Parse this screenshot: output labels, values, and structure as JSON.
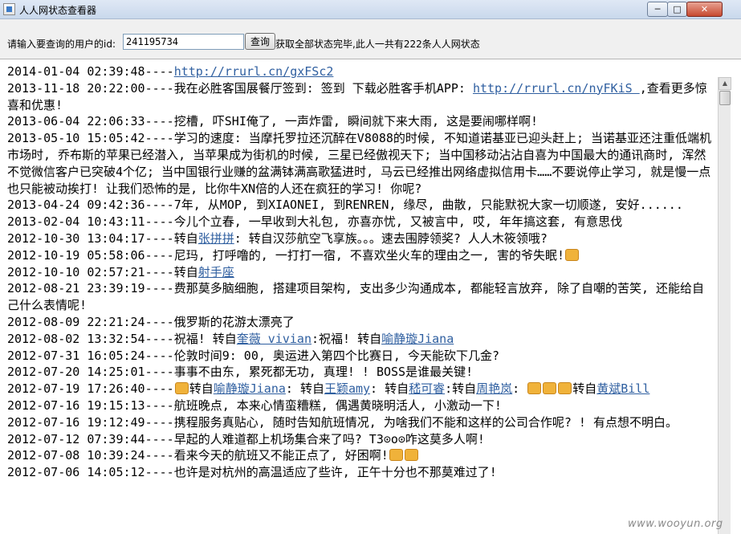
{
  "window": {
    "title": "人人网状态查看器",
    "min_label": "─",
    "max_label": "□",
    "close_label": "✕"
  },
  "query": {
    "label": "请输入要查询的用户的id:",
    "uid_value": "241195734",
    "button_label": "查询",
    "status_text": "获取全部状态完毕,此人一共有222条人人网状态"
  },
  "entries": [
    {
      "ts": "2014-01-04 02:39:48----",
      "parts": [
        {
          "t": "link",
          "v": "http://rrurl.cn/gxFSc2"
        }
      ]
    },
    {
      "ts": "2013-11-18 20:22:00----",
      "parts": [
        {
          "t": "text",
          "v": "我在必胜客国展餐厅签到: 签到 下载必胜客手机APP: "
        },
        {
          "t": "link",
          "v": "http://rrurl.cn/nyFKiS "
        },
        {
          "t": "text",
          "v": " ,查看更多惊喜和优惠!"
        }
      ]
    },
    {
      "ts": "2013-06-04 22:06:33----",
      "parts": [
        {
          "t": "text",
          "v": "挖槽, 吓SHI俺了, 一声炸雷, 瞬间就下来大雨, 这是要闹哪样啊!"
        }
      ]
    },
    {
      "ts": "2013-05-10 15:05:42----",
      "parts": [
        {
          "t": "text",
          "v": "学习的速度: 当摩托罗拉还沉醉在V8088的时候, 不知道诺基亚已迎头赶上; 当诺基亚还注重低端机市场时, 乔布斯的苹果已经潜入, 当苹果成为街机的时候, 三星已经傲视天下; 当中国移动沾沾自喜为中国最大的通讯商时, 浑然不觉微信客户已突破4个亿; 当中国银行业赚的盆满钵满高歌猛进时, 马云已经推出网络虚拟信用卡……不要说停止学习, 就是慢一点也只能被动挨打! 让我们恐怖的是, 比你牛XN倍的人还在疯狂的学习! 你呢?"
        }
      ]
    },
    {
      "ts": "2013-04-24 09:42:36----",
      "parts": [
        {
          "t": "text",
          "v": "7年, 从MOP, 到XIAONEI, 到RENREN, 缘尽, 曲散, 只能默祝大家一切顺遂, 安好......"
        }
      ]
    },
    {
      "ts": "2013-02-04 10:43:11----",
      "parts": [
        {
          "t": "text",
          "v": "今儿个立春, 一早收到大礼包, 亦喜亦忧, 又被言中, 哎, 年年搞这套, 有意思伐"
        }
      ]
    },
    {
      "ts": "2012-10-30 13:04:17----",
      "parts": [
        {
          "t": "text",
          "v": "转自"
        },
        {
          "t": "link",
          "v": "张拼拼"
        },
        {
          "t": "text",
          "v": ": 转自汉莎航空飞享族。。。速去围脖领奖? 人人木筱领哦?"
        }
      ]
    },
    {
      "ts": "2012-10-19 05:58:06----",
      "parts": [
        {
          "t": "text",
          "v": "尼玛, 打呼噜的, 一打打一宿, 不喜欢坐火车的理由之一, 害的爷失眠!"
        },
        {
          "t": "emo",
          "v": "angry-emoticon"
        }
      ]
    },
    {
      "ts": "2012-10-10 02:57:21----",
      "parts": [
        {
          "t": "text",
          "v": "转自"
        },
        {
          "t": "link",
          "v": "射手座"
        }
      ]
    },
    {
      "ts": "2012-08-21 23:39:19----",
      "parts": [
        {
          "t": "text",
          "v": "费那莫多脑细胞, 搭建项目架构, 支出多少沟通成本, 都能轻言放弃, 除了自嘲的苦笑, 还能给自己什么表情呢!"
        }
      ]
    },
    {
      "ts": "2012-08-09 22:21:24----",
      "parts": [
        {
          "t": "text",
          "v": "俄罗斯的花游太漂亮了"
        }
      ]
    },
    {
      "ts": "2012-08-02 13:32:54----",
      "parts": [
        {
          "t": "text",
          "v": "祝福! 转自"
        },
        {
          "t": "link",
          "v": "奎薇 vivian"
        },
        {
          "t": "text",
          "v": ":祝福! 转自"
        },
        {
          "t": "link",
          "v": "喻静璇Jiana"
        }
      ]
    },
    {
      "ts": "2012-07-31 16:05:24----",
      "parts": [
        {
          "t": "text",
          "v": "伦敦时间9: 00, 奥运进入第四个比赛日, 今天能砍下几金?"
        }
      ]
    },
    {
      "ts": "2012-07-20 14:25:01----",
      "parts": [
        {
          "t": "text",
          "v": "事事不由东, 累死都无功, 真理! ! BOSS是谁最关键!"
        }
      ]
    },
    {
      "ts": "2012-07-19 17:26:40----",
      "parts": [
        {
          "t": "emo",
          "v": "wave-emoticon"
        },
        {
          "t": "text",
          "v": "转自"
        },
        {
          "t": "link",
          "v": "喻静璇Jiana"
        },
        {
          "t": "text",
          "v": ": 转自"
        },
        {
          "t": "link",
          "v": "王颖amy"
        },
        {
          "t": "text",
          "v": ": 转自"
        },
        {
          "t": "link",
          "v": "嵇可睿"
        },
        {
          "t": "text",
          "v": ":转自"
        },
        {
          "t": "link",
          "v": "周艳岚"
        },
        {
          "t": "text",
          "v": ": "
        },
        {
          "t": "emo",
          "v": "heart-emoticon"
        },
        {
          "t": "emo",
          "v": "heart-emoticon"
        },
        {
          "t": "emo",
          "v": "smile-emoticon"
        },
        {
          "t": "text",
          "v": "转自"
        },
        {
          "t": "link",
          "v": "黄斌Bill"
        }
      ]
    },
    {
      "ts": "2012-07-16 19:15:13----",
      "parts": [
        {
          "t": "text",
          "v": "航班晚点, 本来心情蛮糟糕, 偶遇黄晓明活人, 小激动一下!"
        }
      ]
    },
    {
      "ts": "2012-07-16 19:12:49----",
      "parts": [
        {
          "t": "text",
          "v": "携程服务真贴心, 随时告知航班情况, 为啥我们不能和这样的公司合作呢? ! 有点想不明白。"
        }
      ]
    },
    {
      "ts": "2012-07-12 07:39:44----",
      "parts": [
        {
          "t": "text",
          "v": "早起的人难道都上机场集合来了吗? T3⊙o⊙咋这莫多人啊!"
        }
      ]
    },
    {
      "ts": "2012-07-08 10:39:24----",
      "parts": [
        {
          "t": "text",
          "v": "看来今天的航班又不能正点了, 好困啊!"
        },
        {
          "t": "emo",
          "v": "sleepy-emoticon"
        },
        {
          "t": "emo",
          "v": "dizzy-emoticon"
        }
      ]
    },
    {
      "ts": "2012-07-06 14:05:12----",
      "parts": [
        {
          "t": "text",
          "v": "也许是对杭州的高温适应了些许, 正午十分也不那莫难过了!"
        }
      ]
    }
  ],
  "watermark": "www.wooyun.org"
}
